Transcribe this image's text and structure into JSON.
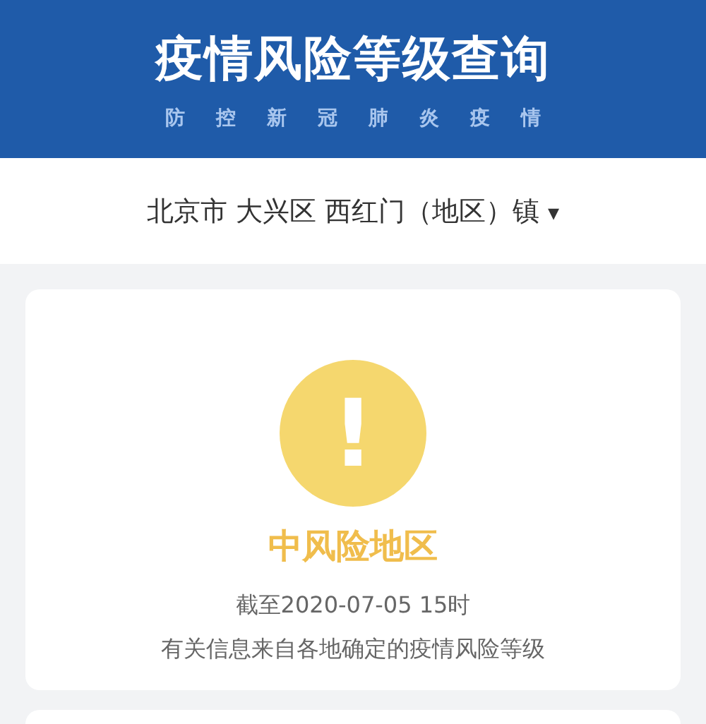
{
  "header": {
    "title": "疫情风险等级查询",
    "subtitle": [
      "防",
      "控",
      "新",
      "冠",
      "肺",
      "炎",
      "疫",
      "情"
    ]
  },
  "location": {
    "value": "北京市 大兴区 西红门（地区）镇",
    "caret": "▾"
  },
  "result": {
    "color": "#f5d76e",
    "glyph": "!",
    "label": "中风险地区",
    "time": "截至2020-07-05 15时",
    "note": "有关信息来自各地确定的疫情风险等级"
  }
}
